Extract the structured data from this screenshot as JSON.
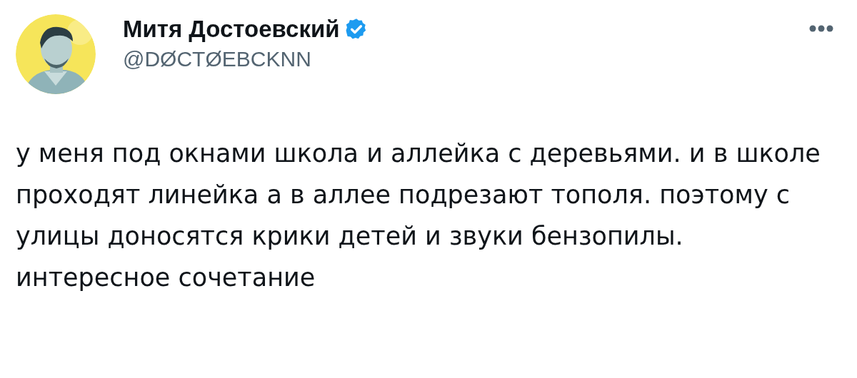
{
  "author": {
    "name": "Митя Достоевский",
    "verified": true,
    "handle": "@DØCTØEBCKNN"
  },
  "text": "у меня под окнами школа и аллейка с деревьями. и в школе проходят линейка а в аллее подрезают тополя. поэтому с улицы доносятся крики детей и звуки бензопилы. интересное сочетание"
}
